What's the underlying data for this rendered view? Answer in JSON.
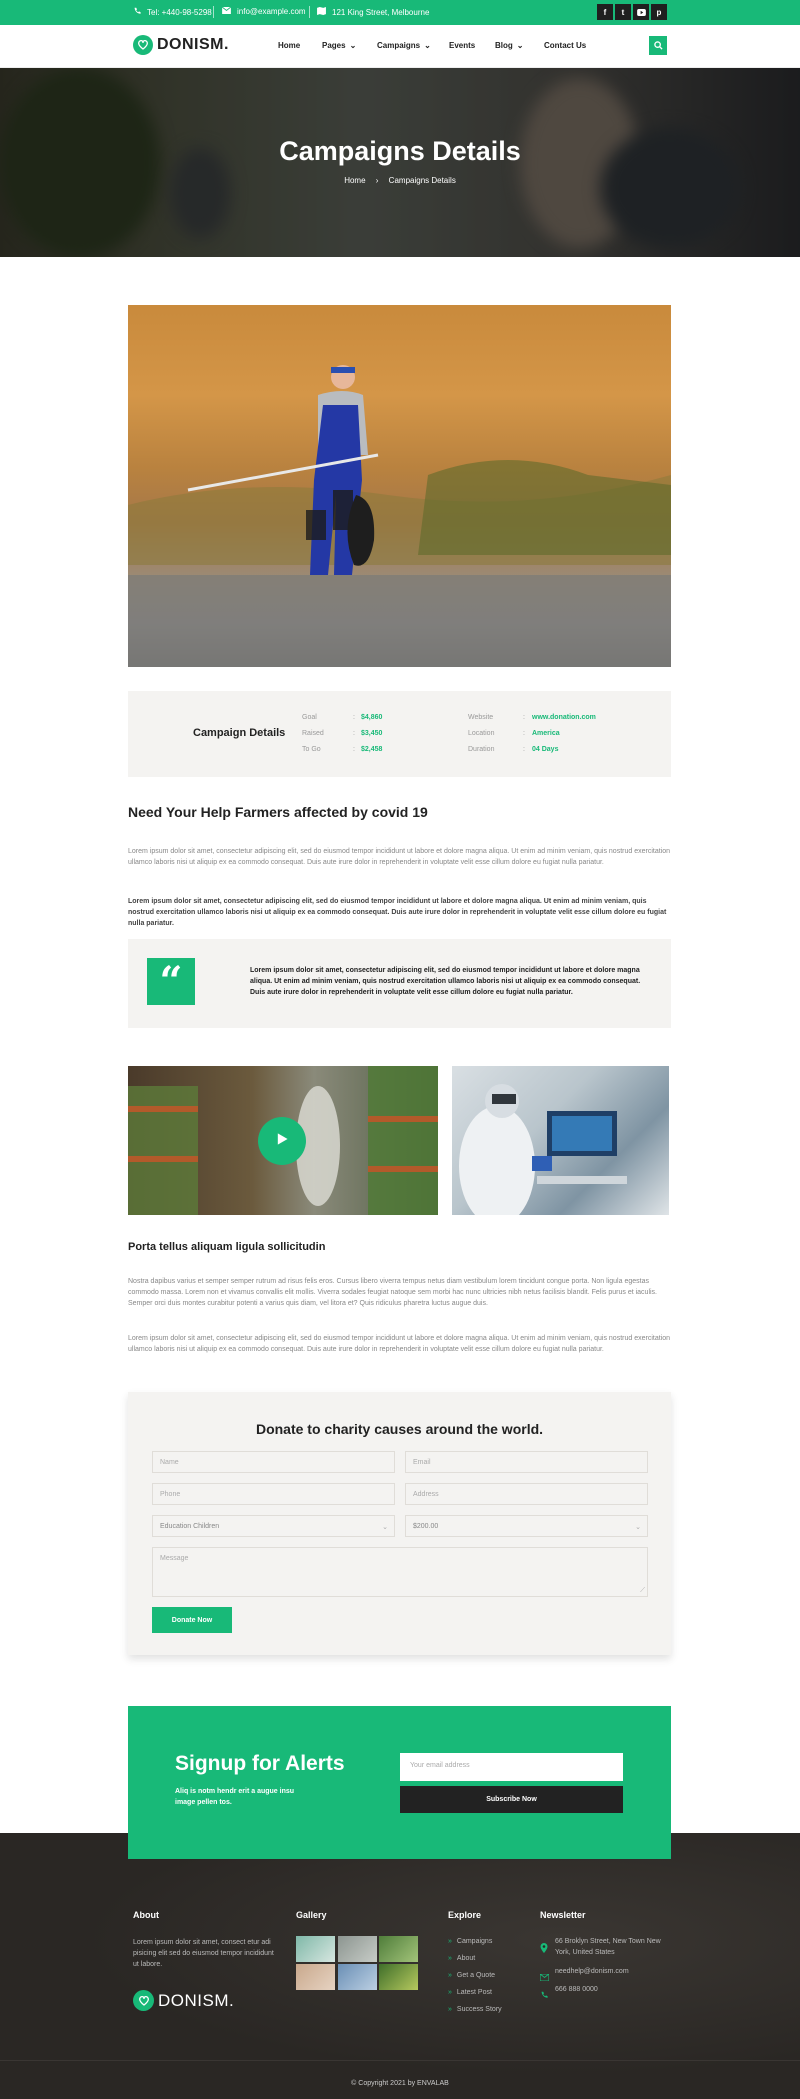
{
  "topbar": {
    "phone": "Tel: +440-98-5298",
    "email": "info@example.com",
    "address": "121 King Street, Melbourne",
    "social": [
      "f",
      "t",
      "y",
      "p"
    ]
  },
  "header": {
    "logo": "DONISM.",
    "nav": [
      "Home",
      "Pages",
      "Campaigns",
      "Events",
      "Blog",
      "Contact Us"
    ]
  },
  "hero": {
    "title": "Campaigns Details",
    "breadcrumb_home": "Home",
    "breadcrumb_current": "Campaigns Details"
  },
  "details": {
    "heading": "Campaign Details",
    "left": [
      {
        "label": "Goal",
        "value": "$4,860"
      },
      {
        "label": "Raised",
        "value": "$3,450"
      },
      {
        "label": "To Go",
        "value": "$2,458"
      }
    ],
    "right": [
      {
        "label": "Website",
        "value": "www.donation.com"
      },
      {
        "label": "Location",
        "value": "America"
      },
      {
        "label": "Duration",
        "value": "04 Days"
      }
    ]
  },
  "article": {
    "title": "Need Your Help Farmers affected by covid 19",
    "p1": "Lorem ipsum dolor sit amet, consectetur adipiscing elit, sed do eiusmod tempor incididunt ut labore et dolore magna aliqua. Ut enim ad minim veniam, quis nostrud exercitation ullamco laboris nisi ut aliquip ex ea commodo consequat. Duis aute irure dolor in reprehenderit in voluptate velit esse cillum dolore eu fugiat nulla pariatur.",
    "p2": "Lorem ipsum dolor sit amet, consectetur adipiscing elit, sed do eiusmod tempor incididunt ut labore et dolore magna aliqua. Ut enim ad minim veniam, quis nostrud exercitation ullamco laboris nisi ut aliquip ex ea commodo consequat. Duis aute irure dolor in reprehenderit in voluptate velit esse cillum dolore eu fugiat nulla pariatur.",
    "quote": "Lorem ipsum dolor sit amet, consectetur adipiscing elit, sed do eiusmod tempor incididunt ut labore et dolore magna aliqua. Ut enim ad minim veniam, quis nostrud exercitation ullamco laboris nisi ut aliquip ex ea commodo consequat. Duis aute irure dolor in reprehenderit in voluptate velit esse cillum dolore eu fugiat nulla pariatur.",
    "subtitle": "Porta tellus aliquam ligula sollicitudin",
    "p3": "Nostra dapibus varius et semper semper rutrum ad risus felis eros. Cursus libero viverra tempus netus diam vestibulum lorem tincidunt congue porta. Non ligula egestas commodo massa. Lorem non et vivamus convallis elit mollis. Viverra sodales feugiat natoque sem morbi hac nunc ultricies nibh netus facilisis blandit. Felis purus et iaculis. Semper orci duis montes curabitur potenti a varius quis diam, vel litora et? Quis ridiculus pharetra luctus augue duis.",
    "p4": "Lorem ipsum dolor sit amet, consectetur adipiscing elit, sed do eiusmod tempor incididunt ut labore et dolore magna aliqua. Ut enim ad minim veniam, quis nostrud exercitation ullamco laboris nisi ut aliquip ex ea commodo consequat. Duis aute irure dolor in reprehenderit in voluptate velit esse cillum dolore eu fugiat nulla pariatur."
  },
  "donate": {
    "title": "Donate to charity causes around the world.",
    "name_placeholder": "Name",
    "email_placeholder": "Email",
    "phone_placeholder": "Phone",
    "address_placeholder": "Address",
    "cause_selected": "Education Children",
    "amount_selected": "$200.00",
    "message_placeholder": "Message",
    "button": "Donate Now"
  },
  "signup": {
    "title": "Signup for Alerts",
    "text": "Aliq is notm hendr erit a augue insu image pellen tos.",
    "email_placeholder": "Your email address",
    "button": "Subscribe Now"
  },
  "footer": {
    "about_title": "About",
    "about_text": "Lorem ipsum dolor sit amet, consect etur adi pisicing elit sed do eiusmod tempor incididunt ut labore.",
    "logo": "DONISM.",
    "gallery_title": "Gallery",
    "explore_title": "Explore",
    "explore_links": [
      "Campaigns",
      "About",
      "Get a Quote",
      "Latest Post",
      "Success Story"
    ],
    "newsletter_title": "Newsletter",
    "address": "66 Broklyn Street, New Town New York, United States",
    "email": "needhelp@donism.com",
    "phone": "666 888 0000",
    "copyright": "© Copyright 2021 by ENVALAB"
  },
  "colors": {
    "accent": "#18b978",
    "dark": "#222222",
    "panel": "#f4f3f1",
    "footer": "#2a2724"
  }
}
